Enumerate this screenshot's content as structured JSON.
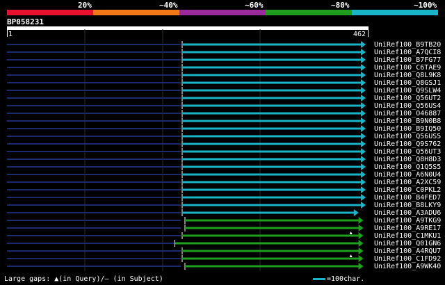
{
  "legend": {
    "labels": [
      "20%",
      "~40%",
      "~60%",
      "~80%",
      "~100%"
    ],
    "colors": [
      "#e8112d",
      "#f07818",
      "#9b2a9b",
      "#1ea01e",
      "#19b4c8"
    ]
  },
  "query": {
    "id": "BP058231",
    "start": "1",
    "end": "462"
  },
  "colors": {
    "query_line": "#1a2a6a",
    "grid": "#2a2a2a",
    "high": "#19b4c8",
    "mid": "#1ea01e",
    "gap_marker": "#ffffff"
  },
  "hits": [
    {
      "name": "UniRef100_B9TB20",
      "start": 1,
      "end": 462,
      "query_from": 0,
      "tier": "high"
    },
    {
      "name": "UniRef100_A7QCI8",
      "start": 1,
      "end": 462,
      "query_from": 0,
      "tier": "high"
    },
    {
      "name": "UniRef100_B7FG77",
      "start": 1,
      "end": 462,
      "query_from": 0,
      "tier": "high"
    },
    {
      "name": "UniRef100_C6TAE9",
      "start": 1,
      "end": 462,
      "query_from": 0,
      "tier": "high"
    },
    {
      "name": "UniRef100_Q8L9K8",
      "start": 1,
      "end": 462,
      "query_from": 0,
      "tier": "high"
    },
    {
      "name": "UniRef100_Q8GSJ1",
      "start": 1,
      "end": 462,
      "query_from": 0,
      "tier": "high"
    },
    {
      "name": "UniRef100_Q9SLW4",
      "start": 1,
      "end": 462,
      "query_from": 0,
      "tier": "high"
    },
    {
      "name": "UniRef100_Q56UT2",
      "start": 1,
      "end": 462,
      "query_from": 0,
      "tier": "high"
    },
    {
      "name": "UniRef100_Q56US4",
      "start": 1,
      "end": 462,
      "query_from": 0,
      "tier": "high"
    },
    {
      "name": "UniRef100_O46887",
      "start": 1,
      "end": 462,
      "query_from": 0,
      "tier": "high"
    },
    {
      "name": "UniRef100_B9N0B8",
      "start": 1,
      "end": 462,
      "query_from": 0,
      "tier": "high"
    },
    {
      "name": "UniRef100_B9IQ50",
      "start": 1,
      "end": 462,
      "query_from": 0,
      "tier": "high"
    },
    {
      "name": "UniRef100_Q56US5",
      "start": 1,
      "end": 462,
      "query_from": 0,
      "tier": "high"
    },
    {
      "name": "UniRef100_Q9S762",
      "start": 1,
      "end": 462,
      "query_from": 0,
      "tier": "high"
    },
    {
      "name": "UniRef100_Q56UT3",
      "start": 1,
      "end": 462,
      "query_from": 0,
      "tier": "high"
    },
    {
      "name": "UniRef100_Q8H8D3",
      "start": 1,
      "end": 462,
      "query_from": 0,
      "tier": "high"
    },
    {
      "name": "UniRef100_Q1Q5S5",
      "start": 1,
      "end": 462,
      "query_from": 0,
      "tier": "high"
    },
    {
      "name": "UniRef100_A6N0U4",
      "start": 1,
      "end": 462,
      "query_from": 0,
      "tier": "high"
    },
    {
      "name": "UniRef100_A2XC59",
      "start": 1,
      "end": 462,
      "query_from": 0,
      "tier": "high"
    },
    {
      "name": "UniRef100_C0PKL2",
      "start": 1,
      "end": 462,
      "query_from": 0,
      "tier": "high"
    },
    {
      "name": "UniRef100_B4FED7",
      "start": 1,
      "end": 462,
      "query_from": 0,
      "tier": "high"
    },
    {
      "name": "UniRef100_B8LKY9",
      "start": 1,
      "end": 462,
      "query_from": 0,
      "tier": "high"
    },
    {
      "name": "UniRef100_A3ADU6",
      "start": 1,
      "end": 444,
      "query_from": 0,
      "tier": "high"
    },
    {
      "name": "UniRef100_A9TKG9",
      "start": 8,
      "end": 456,
      "query_from": 0,
      "tier": "mid"
    },
    {
      "name": "UniRef100_A9RE17",
      "start": 8,
      "end": 456,
      "query_from": 0,
      "tier": "mid"
    },
    {
      "name": "UniRef100_C1MKU1",
      "start": 1,
      "end": 456,
      "query_from": 0,
      "tier": "mid",
      "gap_at": 428
    },
    {
      "name": "UniRef100_Q01GN6",
      "start": -18,
      "end": 456,
      "query_from": 0,
      "tier": "mid"
    },
    {
      "name": "UniRef100_A4RQU7",
      "start": 1,
      "end": 456,
      "query_from": 0,
      "tier": "mid"
    },
    {
      "name": "UniRef100_C1FD92",
      "start": 1,
      "end": 456,
      "query_from": 0,
      "tier": "mid",
      "gap_at": 428
    },
    {
      "name": "UniRef100_A9WK40",
      "start": 8,
      "end": 456,
      "query_from": 0,
      "tier": "mid"
    }
  ],
  "footer": {
    "gaps_label": "Large gaps: ▲(in Query)/– (in Subject)",
    "scale_label": "=100char."
  }
}
